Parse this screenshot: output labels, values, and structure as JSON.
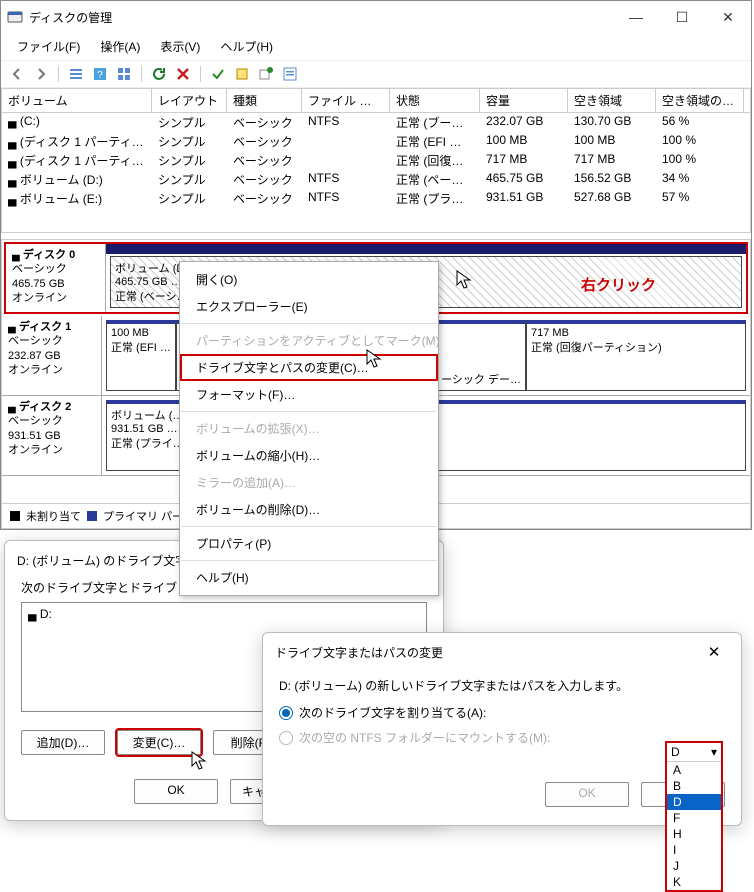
{
  "window": {
    "title": "ディスクの管理",
    "minimize": "—",
    "maximize": "☐",
    "close": "✕"
  },
  "menubar": [
    "ファイル(F)",
    "操作(A)",
    "表示(V)",
    "ヘルプ(H)"
  ],
  "columns": {
    "volume": "ボリューム",
    "layout": "レイアウト",
    "type": "種類",
    "fs": "ファイル システム",
    "status": "状態",
    "capacity": "容量",
    "free": "空き領域",
    "pct": "空き領域の割…"
  },
  "volumes": [
    {
      "name": "(C:)",
      "layout": "シンプル",
      "type": "ベーシック",
      "fs": "NTFS",
      "status": "正常 (ブート…",
      "cap": "232.07 GB",
      "free": "130.70 GB",
      "pct": "56 %"
    },
    {
      "name": "(ディスク 1 パーティショ…",
      "layout": "シンプル",
      "type": "ベーシック",
      "fs": "",
      "status": "正常 (EFI …",
      "cap": "100 MB",
      "free": "100 MB",
      "pct": "100 %"
    },
    {
      "name": "(ディスク 1 パーティショ…",
      "layout": "シンプル",
      "type": "ベーシック",
      "fs": "",
      "status": "正常 (回復…",
      "cap": "717 MB",
      "free": "717 MB",
      "pct": "100 %"
    },
    {
      "name": "ボリューム (D:)",
      "layout": "シンプル",
      "type": "ベーシック",
      "fs": "NTFS",
      "status": "正常 (ペー…",
      "cap": "465.75 GB",
      "free": "156.52 GB",
      "pct": "34 %"
    },
    {
      "name": "ボリューム (E:)",
      "layout": "シンプル",
      "type": "ベーシック",
      "fs": "NTFS",
      "status": "正常 (プラ…",
      "cap": "931.51 GB",
      "free": "527.68 GB",
      "pct": "57 %"
    }
  ],
  "disks": {
    "d0": {
      "name": "ディスク 0",
      "type": "ベーシック",
      "size": "465.75 GB",
      "state": "オンライン",
      "vol_name": "ボリューム  (D…",
      "vol_size": "465.75 GB …",
      "vol_status": "正常 (ベーシ…"
    },
    "d1": {
      "name": "ディスク 1",
      "type": "ベーシック",
      "size": "232.87 GB",
      "state": "オンライン",
      "p1_size": "100 MB",
      "p1_status": "正常 (EFI …",
      "p2_mid": "ーシック デー…",
      "p3_size": "717 MB",
      "p3_status": "正常 (回復パーティション)"
    },
    "d2": {
      "name": "ディスク 2",
      "type": "ベーシック",
      "size": "931.51 GB",
      "state": "オンライン",
      "vol_name": "ボリューム  (…",
      "vol_size": "931.51 GB …",
      "vol_status": "正常 (プライ…"
    }
  },
  "legend": {
    "unalloc": "未割り当て",
    "primary": "プライマリ パー…"
  },
  "annotation_rightclick": "右クリック",
  "context_menu": {
    "open": "開く(O)",
    "explorer": "エクスプローラー(E)",
    "mark_active": "パーティションをアクティブとしてマーク(M)",
    "change_letter": "ドライブ文字とパスの変更(C)…",
    "format": "フォーマット(F)…",
    "extend": "ボリュームの拡張(X)…",
    "shrink": "ボリュームの縮小(H)…",
    "mirror": "ミラーの追加(A)…",
    "delete": "ボリュームの削除(D)…",
    "prop": "プロパティ(P)",
    "help": "ヘルプ(H)"
  },
  "dlg1": {
    "title": "D: (ボリューム) のドライブ文字とパスの変更",
    "msg": "次のドライブ文字とドライブ パスを使ってこのボリュー…",
    "entry": "D:",
    "add": "追加(D)…",
    "change": "変更(C)…",
    "remove": "削除(R…",
    "ok": "OK",
    "cancel": "キャンセル"
  },
  "dlg2": {
    "title": "ドライブ文字またはパスの変更",
    "msg": "D: (ボリューム) の新しいドライブ文字またはパスを入力します。",
    "opt_assign": "次のドライブ文字を割り当てる(A):",
    "opt_mount": "次の空の NTFS フォルダーにマウントする(M):",
    "ok": "OK",
    "cancel": "キャ…",
    "selected_letter": "D",
    "options": [
      "A",
      "B",
      "D",
      "F",
      "H",
      "I",
      "J",
      "K"
    ]
  }
}
